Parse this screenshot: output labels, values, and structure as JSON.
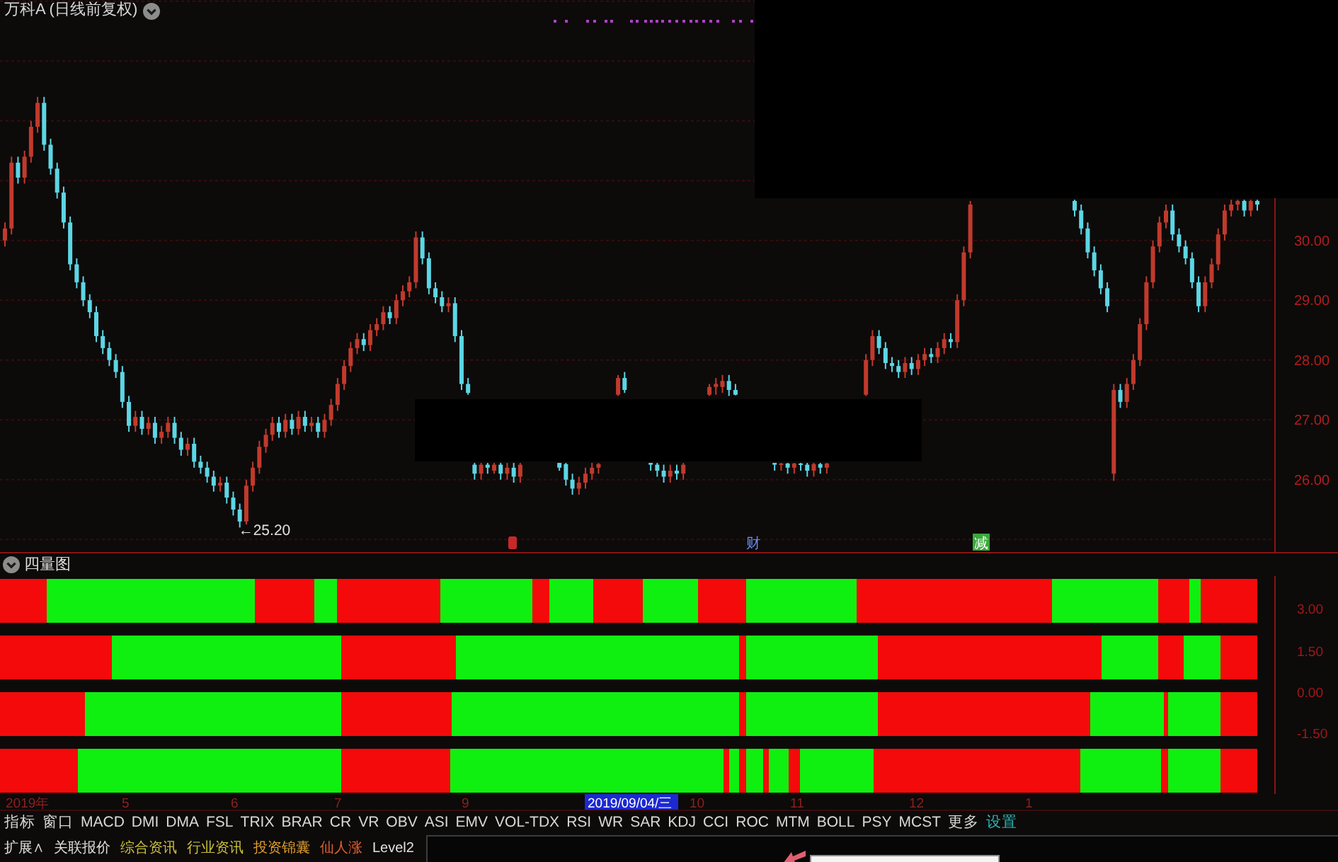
{
  "price_chart": {
    "title": "万科A (日线前复权)",
    "low_label": "←25.20",
    "chart_data": {
      "type": "candlestick",
      "grid": true,
      "ylim": [
        24.79,
        34.02
      ],
      "yticks": [
        {
          "value": 30,
          "label": "30.00"
        },
        {
          "value": 29,
          "label": "29.00"
        },
        {
          "value": 28,
          "label": "28.00"
        },
        {
          "value": 27,
          "label": "27.00"
        },
        {
          "value": 26,
          "label": "26.00"
        }
      ],
      "categories": [
        null,
        null,
        null,
        null,
        null,
        null,
        null,
        null,
        null,
        null,
        null,
        null,
        null,
        null,
        null,
        null,
        null,
        null,
        null,
        null,
        null,
        null,
        null,
        null,
        null,
        null,
        null,
        null,
        null,
        null,
        null,
        null,
        null,
        null,
        null,
        null,
        null,
        null,
        null,
        null,
        null,
        null,
        null,
        null,
        null,
        null,
        null,
        null,
        null,
        null,
        null,
        null,
        null,
        null,
        null,
        null,
        null,
        null,
        null,
        null,
        null,
        null,
        null,
        null,
        null,
        null,
        null,
        null,
        null,
        null,
        null,
        null,
        null,
        null,
        null,
        null,
        null,
        null,
        null,
        null,
        null,
        null,
        null,
        null,
        null,
        null,
        null,
        null,
        null,
        null,
        null,
        null,
        null,
        null,
        null,
        null,
        null,
        null,
        null,
        null,
        null,
        null,
        null,
        null,
        null,
        null,
        null,
        null,
        null,
        null,
        null,
        null,
        null,
        null,
        null,
        null,
        null,
        null,
        null,
        null,
        null,
        null,
        null,
        null,
        null,
        null,
        null,
        null,
        null,
        null,
        null,
        null,
        null,
        null,
        null,
        null,
        null,
        null,
        null,
        null,
        null,
        null,
        null,
        null,
        null,
        null,
        null,
        null,
        null,
        null,
        null,
        null,
        null,
        null,
        null,
        null,
        null,
        null,
        null,
        null,
        null,
        null,
        null,
        null,
        null,
        null,
        null,
        null,
        null,
        null,
        null,
        null,
        null,
        null,
        null,
        null,
        null,
        null,
        null,
        null,
        null,
        null,
        null,
        null,
        null,
        null,
        null,
        null,
        null,
        null,
        null,
        null,
        null
      ],
      "ohlc": [
        [
          30.0,
          30.3,
          29.9,
          30.2
        ],
        [
          30.2,
          31.4,
          30.1,
          31.3
        ],
        [
          31.3,
          31.4,
          30.95,
          31.05
        ],
        [
          31.05,
          31.5,
          30.95,
          31.4
        ],
        [
          31.4,
          32.0,
          31.3,
          31.9
        ],
        [
          31.9,
          32.4,
          31.8,
          32.3
        ],
        [
          32.3,
          32.4,
          31.5,
          31.6
        ],
        [
          31.6,
          31.7,
          31.1,
          31.2
        ],
        [
          31.2,
          31.3,
          30.7,
          30.8
        ],
        [
          30.8,
          30.9,
          30.2,
          30.3
        ],
        [
          30.3,
          30.4,
          29.5,
          29.6
        ],
        [
          29.6,
          29.7,
          29.2,
          29.3
        ],
        [
          29.3,
          29.4,
          28.9,
          29.0
        ],
        [
          29.0,
          29.1,
          28.7,
          28.8
        ],
        [
          28.8,
          28.9,
          28.3,
          28.4
        ],
        [
          28.4,
          28.5,
          28.1,
          28.2
        ],
        [
          28.2,
          28.3,
          27.9,
          28.0
        ],
        [
          28.0,
          28.1,
          27.7,
          27.8
        ],
        [
          27.8,
          27.9,
          27.2,
          27.3
        ],
        [
          27.3,
          27.4,
          26.8,
          26.9
        ],
        [
          26.9,
          27.15,
          26.8,
          27.05
        ],
        [
          27.05,
          27.15,
          26.75,
          26.85
        ],
        [
          26.85,
          27.05,
          26.75,
          26.95
        ],
        [
          26.95,
          27.05,
          26.6,
          26.7
        ],
        [
          26.7,
          26.9,
          26.6,
          26.8
        ],
        [
          26.8,
          27.05,
          26.7,
          26.95
        ],
        [
          26.95,
          27.05,
          26.6,
          26.7
        ],
        [
          26.7,
          26.8,
          26.4,
          26.5
        ],
        [
          26.5,
          26.7,
          26.4,
          26.6
        ],
        [
          26.6,
          26.7,
          26.2,
          26.3
        ],
        [
          26.3,
          26.4,
          26.1,
          26.2
        ],
        [
          26.2,
          26.3,
          25.95,
          26.05
        ],
        [
          26.05,
          26.15,
          25.8,
          25.9
        ],
        [
          25.9,
          26.05,
          25.8,
          25.95
        ],
        [
          25.95,
          26.05,
          25.6,
          25.7
        ],
        [
          25.7,
          25.8,
          25.4,
          25.5
        ],
        [
          25.5,
          25.6,
          25.2,
          25.3
        ],
        [
          25.3,
          26.0,
          25.25,
          25.9
        ],
        [
          25.9,
          26.3,
          25.8,
          26.2
        ],
        [
          26.2,
          26.65,
          26.1,
          26.55
        ],
        [
          26.55,
          26.85,
          26.45,
          26.75
        ],
        [
          26.75,
          27.05,
          26.65,
          26.95
        ],
        [
          26.95,
          27.05,
          26.7,
          26.8
        ],
        [
          26.8,
          27.1,
          26.7,
          27.0
        ],
        [
          27.0,
          27.1,
          26.75,
          26.85
        ],
        [
          26.85,
          27.15,
          26.75,
          27.05
        ],
        [
          27.05,
          27.15,
          26.8,
          26.9
        ],
        [
          26.9,
          27.05,
          26.8,
          26.95
        ],
        [
          26.95,
          27.05,
          26.7,
          26.8
        ],
        [
          26.8,
          27.1,
          26.7,
          27.0
        ],
        [
          27.0,
          27.35,
          26.9,
          27.25
        ],
        [
          27.25,
          27.7,
          27.15,
          27.6
        ],
        [
          27.6,
          28.0,
          27.5,
          27.9
        ],
        [
          27.9,
          28.3,
          27.8,
          28.2
        ],
        [
          28.2,
          28.45,
          28.1,
          28.35
        ],
        [
          28.35,
          28.45,
          28.15,
          28.25
        ],
        [
          28.25,
          28.6,
          28.15,
          28.5
        ],
        [
          28.5,
          28.7,
          28.4,
          28.6
        ],
        [
          28.6,
          28.9,
          28.5,
          28.8
        ],
        [
          28.8,
          28.9,
          28.6,
          28.7
        ],
        [
          28.7,
          29.1,
          28.6,
          29.0
        ],
        [
          29.0,
          29.25,
          28.9,
          29.15
        ],
        [
          29.15,
          29.4,
          29.05,
          29.3
        ],
        [
          29.3,
          30.15,
          29.2,
          30.05
        ],
        [
          30.05,
          30.15,
          29.6,
          29.7
        ],
        [
          29.7,
          29.8,
          29.1,
          29.2
        ],
        [
          29.2,
          29.3,
          28.95,
          29.05
        ],
        [
          29.05,
          29.15,
          28.8,
          28.9
        ],
        [
          28.9,
          29.05,
          28.8,
          28.95
        ],
        [
          28.95,
          29.05,
          28.3,
          28.4
        ],
        [
          28.4,
          28.5,
          27.5,
          27.6
        ],
        [
          27.6,
          27.7,
          27.42,
          27.45
        ],
        [
          26.25,
          26.28,
          26.0,
          26.1
        ],
        [
          26.1,
          26.28,
          26.0,
          26.25
        ],
        [
          26.25,
          26.28,
          26.1,
          26.2
        ],
        [
          26.15,
          26.28,
          26.1,
          26.25
        ],
        [
          26.25,
          26.28,
          26.0,
          26.1
        ],
        [
          26.1,
          26.28,
          26.0,
          26.2
        ],
        [
          26.2,
          26.28,
          25.95,
          26.05
        ],
        [
          26.05,
          26.28,
          25.95,
          26.25
        ],
        null,
        null,
        null,
        null,
        null,
        [
          26.28,
          26.28,
          26.15,
          26.2
        ],
        [
          26.26,
          26.28,
          25.9,
          26.0
        ],
        [
          26.0,
          26.1,
          25.75,
          25.85
        ],
        [
          25.85,
          26.05,
          25.75,
          25.95
        ],
        [
          25.95,
          26.2,
          25.85,
          26.1
        ],
        [
          26.1,
          26.28,
          26.0,
          26.2
        ],
        [
          26.2,
          26.28,
          26.1,
          26.26
        ],
        null,
        null,
        [
          27.42,
          27.75,
          27.4,
          27.7
        ],
        [
          27.7,
          27.8,
          27.45,
          27.5
        ],
        null,
        null,
        null,
        [
          26.28,
          26.28,
          26.15,
          26.25
        ],
        [
          26.25,
          26.28,
          26.05,
          26.15
        ],
        [
          26.15,
          26.25,
          25.95,
          26.05
        ],
        [
          26.05,
          26.25,
          25.95,
          26.15
        ],
        [
          26.15,
          26.25,
          26.0,
          26.1
        ],
        [
          26.1,
          26.28,
          26.0,
          26.25
        ],
        null,
        null,
        null,
        [
          27.42,
          27.6,
          27.4,
          27.55
        ],
        [
          27.55,
          27.7,
          27.42,
          27.6
        ],
        [
          27.55,
          27.75,
          27.45,
          27.65
        ],
        [
          27.65,
          27.75,
          27.4,
          27.5
        ],
        [
          27.5,
          27.6,
          27.41,
          27.42
        ],
        null,
        null,
        null,
        null,
        null,
        [
          26.28,
          26.28,
          26.15,
          26.25
        ],
        [
          26.25,
          26.28,
          26.15,
          26.27
        ],
        [
          26.27,
          26.28,
          26.1,
          26.2
        ],
        [
          26.2,
          26.28,
          26.1,
          26.27
        ],
        [
          26.27,
          26.28,
          26.15,
          26.25
        ],
        [
          26.25,
          26.28,
          26.05,
          26.15
        ],
        [
          26.15,
          26.28,
          26.05,
          26.26
        ],
        [
          26.26,
          26.28,
          26.1,
          26.2
        ],
        [
          26.2,
          26.28,
          26.1,
          26.27
        ],
        null,
        null,
        null,
        null,
        null,
        [
          27.42,
          28.1,
          27.4,
          28.0
        ],
        [
          28.0,
          28.5,
          27.9,
          28.4
        ],
        [
          28.4,
          28.5,
          28.1,
          28.2
        ],
        [
          28.2,
          28.3,
          27.85,
          27.95
        ],
        [
          27.95,
          28.05,
          27.8,
          27.9
        ],
        [
          27.9,
          28.0,
          27.7,
          27.8
        ],
        [
          27.8,
          28.05,
          27.7,
          27.95
        ],
        [
          27.95,
          28.05,
          27.75,
          27.85
        ],
        [
          27.85,
          28.1,
          27.75,
          28.0
        ],
        [
          28.0,
          28.2,
          27.9,
          28.1
        ],
        [
          28.1,
          28.2,
          27.95,
          28.05
        ],
        [
          28.05,
          28.3,
          27.95,
          28.2
        ],
        [
          28.2,
          28.45,
          28.1,
          28.35
        ],
        [
          28.35,
          28.45,
          28.2,
          28.3
        ],
        [
          28.3,
          29.1,
          28.2,
          29.0
        ],
        [
          29.0,
          29.9,
          28.9,
          29.8
        ],
        [
          29.8,
          30.66,
          29.7,
          30.6
        ],
        null,
        null,
        null,
        null,
        null,
        null,
        null,
        null,
        null,
        null,
        null,
        null,
        null,
        null,
        null,
        [
          30.66,
          30.68,
          30.4,
          30.5
        ],
        [
          30.5,
          30.6,
          30.1,
          30.2
        ],
        [
          30.2,
          30.3,
          29.7,
          29.8
        ],
        [
          29.8,
          29.9,
          29.4,
          29.5
        ],
        [
          29.5,
          29.6,
          29.1,
          29.2
        ],
        [
          29.2,
          29.3,
          28.8,
          28.9
        ],
        [
          26.1,
          27.6,
          25.98,
          27.5
        ],
        [
          27.5,
          27.6,
          27.2,
          27.3
        ],
        [
          27.3,
          27.7,
          27.2,
          27.6
        ],
        [
          27.6,
          28.1,
          27.5,
          28.0
        ],
        [
          28.0,
          28.7,
          27.9,
          28.6
        ],
        [
          28.6,
          29.4,
          28.5,
          29.3
        ],
        [
          29.3,
          30.0,
          29.2,
          29.9
        ],
        [
          29.9,
          30.4,
          29.8,
          30.3
        ],
        [
          30.3,
          30.6,
          30.2,
          30.5
        ],
        [
          30.5,
          30.6,
          30.0,
          30.1
        ],
        [
          30.1,
          30.2,
          29.8,
          29.9
        ],
        [
          29.9,
          30.0,
          29.6,
          29.7
        ],
        [
          29.7,
          29.8,
          29.2,
          29.3
        ],
        [
          29.3,
          29.4,
          28.8,
          28.9
        ],
        [
          28.9,
          29.4,
          28.8,
          29.3
        ],
        [
          29.3,
          29.7,
          29.2,
          29.6
        ],
        [
          29.6,
          30.2,
          29.5,
          30.1
        ],
        [
          30.1,
          30.6,
          30.0,
          30.5
        ],
        [
          30.5,
          30.68,
          30.4,
          30.6
        ],
        [
          30.6,
          30.68,
          30.5,
          30.66
        ],
        [
          30.66,
          30.68,
          30.4,
          30.5
        ],
        [
          30.5,
          30.68,
          30.4,
          30.66
        ],
        [
          30.66,
          30.68,
          30.5,
          30.6
        ]
      ]
    }
  },
  "event_markers": [
    {
      "kind": "icon",
      "color": "#c82828"
    },
    {
      "label": "财",
      "kind": "text",
      "color": "#6c8ef0"
    },
    {
      "label": "减",
      "kind": "badge",
      "color": "#3aa83a"
    }
  ],
  "indicator_panel": {
    "title": "四量图",
    "axis": [
      "3.00",
      "1.50",
      "0.00",
      "-1.50"
    ]
  },
  "date_axis": {
    "ticks": [
      "2019年",
      "5",
      "6",
      "7",
      "9",
      "10",
      "11",
      "12",
      "1"
    ],
    "cursor": "2019/09/04/三"
  },
  "indicator_tabs": [
    {
      "label": "指标",
      "color": "#d8d8d8"
    },
    {
      "label": "窗口",
      "color": "#d8d8d8"
    },
    {
      "label": "MACD",
      "color": "#d8d8d8"
    },
    {
      "label": "DMI",
      "color": "#d8d8d8"
    },
    {
      "label": "DMA",
      "color": "#d8d8d8"
    },
    {
      "label": "FSL",
      "color": "#d8d8d8"
    },
    {
      "label": "TRIX",
      "color": "#d8d8d8"
    },
    {
      "label": "BRAR",
      "color": "#d8d8d8"
    },
    {
      "label": "CR",
      "color": "#d8d8d8"
    },
    {
      "label": "VR",
      "color": "#d8d8d8"
    },
    {
      "label": "OBV",
      "color": "#d8d8d8"
    },
    {
      "label": "ASI",
      "color": "#d8d8d8"
    },
    {
      "label": "EMV",
      "color": "#d8d8d8"
    },
    {
      "label": "VOL-TDX",
      "color": "#d8d8d8"
    },
    {
      "label": "RSI",
      "color": "#d8d8d8"
    },
    {
      "label": "WR",
      "color": "#d8d8d8"
    },
    {
      "label": "SAR",
      "color": "#d8d8d8"
    },
    {
      "label": "KDJ",
      "color": "#d8d8d8"
    },
    {
      "label": "CCI",
      "color": "#d8d8d8"
    },
    {
      "label": "ROC",
      "color": "#d8d8d8"
    },
    {
      "label": "MTM",
      "color": "#d8d8d8"
    },
    {
      "label": "BOLL",
      "color": "#d8d8d8"
    },
    {
      "label": "PSY",
      "color": "#d8d8d8"
    },
    {
      "label": "MCST",
      "color": "#d8d8d8"
    },
    {
      "label": "更多",
      "color": "#d8d8d8"
    },
    {
      "label": "设置",
      "color": "#2ab4b4"
    }
  ],
  "info_tabs": [
    {
      "label": "扩展∧",
      "color": "#e0e0e0"
    },
    {
      "label": "关联报价",
      "color": "#e0e0e0"
    },
    {
      "label": "综合资讯",
      "color": "#c8c040"
    },
    {
      "label": "行业资讯",
      "color": "#c8c040"
    },
    {
      "label": "投资锦囊",
      "color": "#e0a030"
    },
    {
      "label": "仙人涨",
      "color": "#e06030"
    },
    {
      "label": "Level2",
      "color": "#e0e0e0"
    }
  ]
}
